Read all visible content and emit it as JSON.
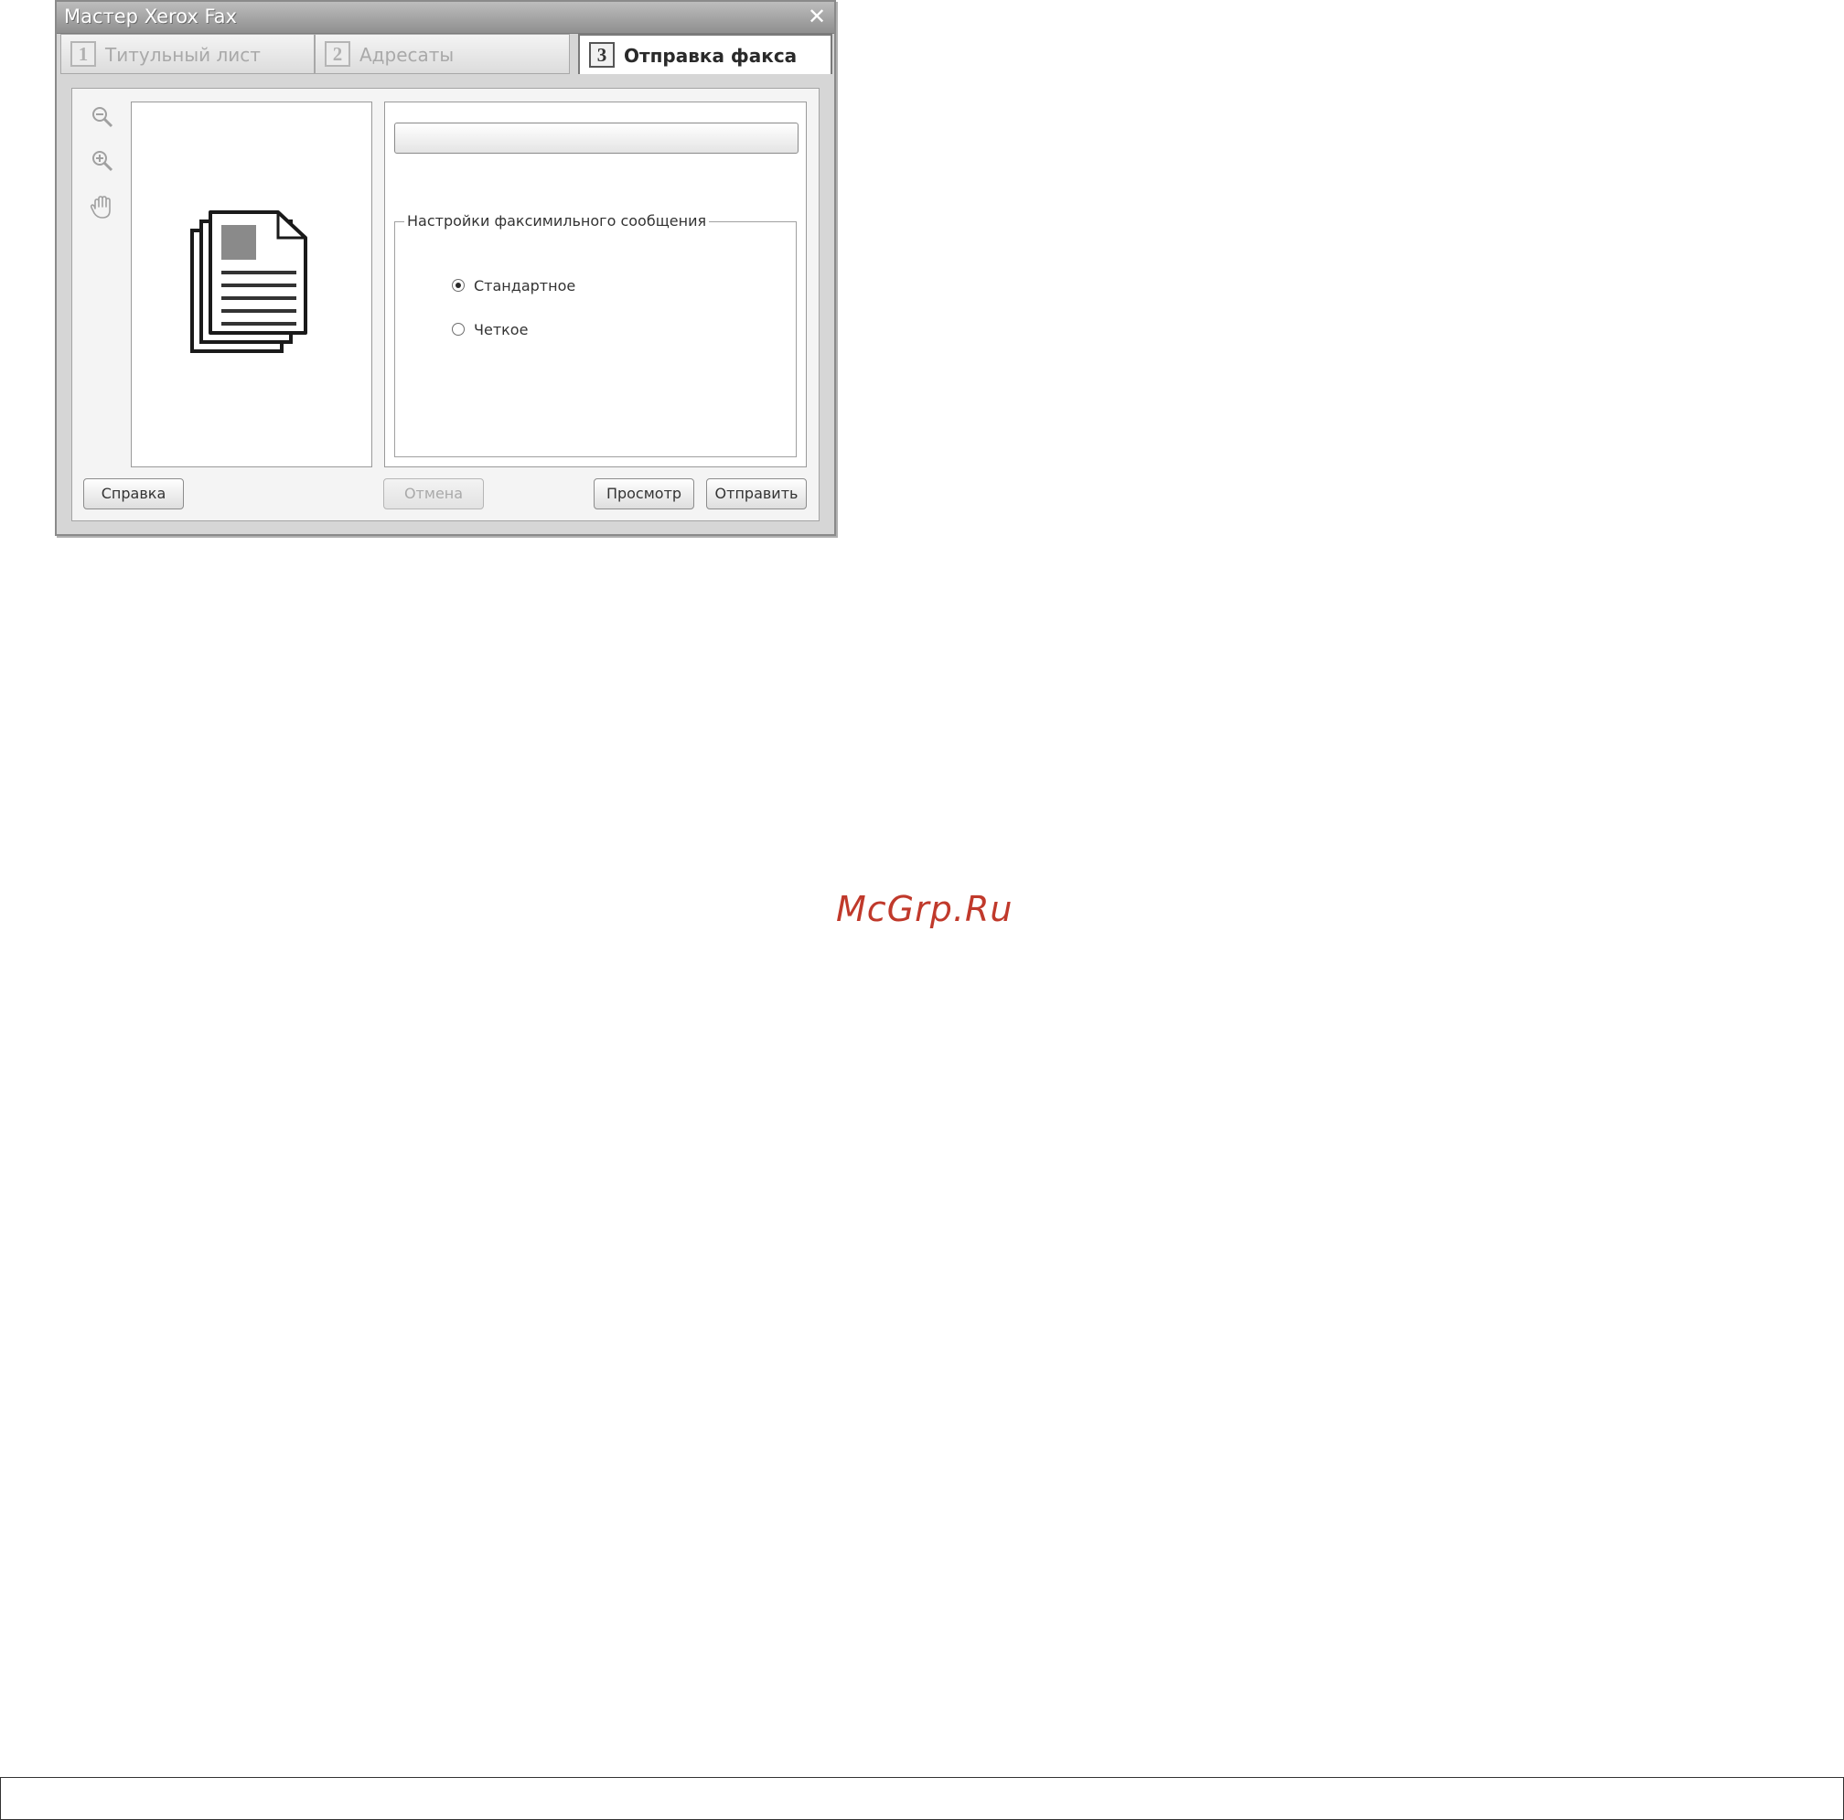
{
  "window": {
    "title": "Мастер Xerox Fax",
    "close_symbol": "✕"
  },
  "tabs": [
    {
      "number": "1",
      "label": "Титульный лист",
      "active": false
    },
    {
      "number": "2",
      "label": "Адресаты",
      "active": false
    },
    {
      "number": "3",
      "label": "Отправка факса",
      "active": true
    }
  ],
  "toolbar": {
    "icons": [
      "zoom-out-icon",
      "zoom-in-icon",
      "hand-pan-icon"
    ]
  },
  "progress": {
    "value": 0
  },
  "fax_settings": {
    "legend": "Настройки факсимильного сообщения",
    "options": [
      {
        "label": "Стандартное",
        "checked": true
      },
      {
        "label": "Четкое",
        "checked": false
      }
    ]
  },
  "buttons": {
    "help": "Справка",
    "cancel": "Отмена",
    "preview": "Просмотр",
    "send": "Отправить"
  },
  "watermark": "McGrp.Ru",
  "colors": {
    "watermark": "#c0392b",
    "titlebar": "#9e9e9e"
  }
}
